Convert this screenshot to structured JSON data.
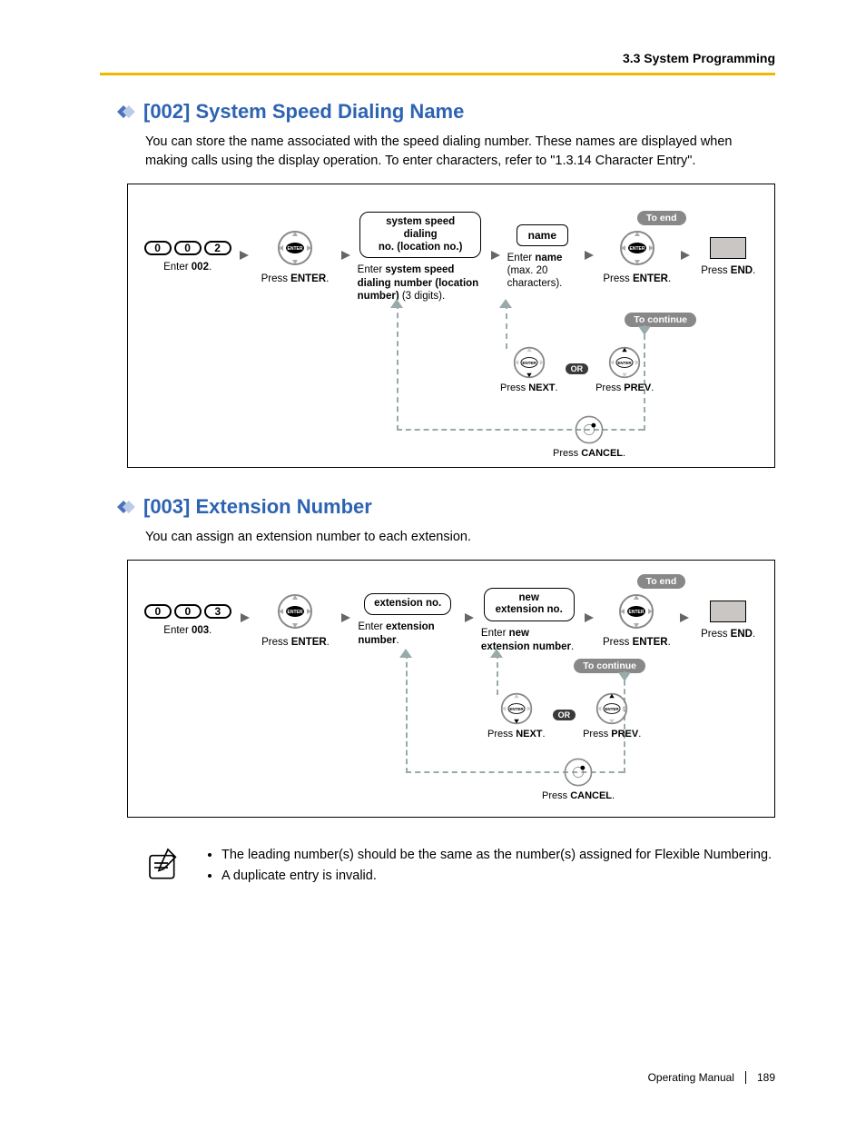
{
  "header": {
    "section": "3.3 System Programming"
  },
  "section1": {
    "heading": "[002] System Speed Dialing Name",
    "paragraph": "You can store the name associated with the speed dialing number. These names are displayed when making calls using the display operation. To enter characters, refer to \"1.3.14 Character Entry\".",
    "flow": {
      "step1": {
        "keys": [
          "0",
          "0",
          "2"
        ],
        "caption_a": "Enter ",
        "caption_b": "002",
        "caption_c": "."
      },
      "step2": {
        "caption_a": "Press ",
        "caption_b": "ENTER",
        "caption_c": "."
      },
      "step3": {
        "box_l1": "system speed dialing",
        "box_l2": "no. (location no.)",
        "cap_a": "Enter ",
        "cap_b": "system speed dialing number (location number)",
        "cap_c": " (3 digits)."
      },
      "step4": {
        "box": "name",
        "cap_a": "Enter ",
        "cap_b": "name",
        "cap_c": " (max. 20 characters)."
      },
      "step5": {
        "caption_a": "Press ",
        "caption_b": "ENTER",
        "caption_c": "."
      },
      "step6": {
        "caption_a": "Press ",
        "caption_b": "END",
        "caption_c": "."
      },
      "to_end": "To end",
      "to_continue": "To continue",
      "next": {
        "a": "Press ",
        "b": "NEXT",
        "c": "."
      },
      "prev": {
        "a": "Press ",
        "b": "PREV",
        "c": "."
      },
      "or": "OR",
      "cancel": {
        "a": "Press ",
        "b": "CANCEL",
        "c": "."
      }
    }
  },
  "section2": {
    "heading": "[003] Extension Number",
    "paragraph": "You can assign an extension number to each extension.",
    "flow": {
      "step1": {
        "keys": [
          "0",
          "0",
          "3"
        ],
        "caption_a": "Enter ",
        "caption_b": "003",
        "caption_c": "."
      },
      "step2": {
        "caption_a": "Press ",
        "caption_b": "ENTER",
        "caption_c": "."
      },
      "step3": {
        "box": "extension no.",
        "cap_a": "Enter ",
        "cap_b": "extension number",
        "cap_c": "."
      },
      "step4": {
        "box_l1": "new",
        "box_l2": "extension no.",
        "cap_a": "Enter ",
        "cap_b": "new extension number",
        "cap_c": "."
      },
      "step5": {
        "caption_a": "Press ",
        "caption_b": "ENTER",
        "caption_c": "."
      },
      "step6": {
        "caption_a": "Press ",
        "caption_b": "END",
        "caption_c": "."
      },
      "to_end": "To end",
      "to_continue": "To continue",
      "next": {
        "a": "Press ",
        "b": "NEXT",
        "c": "."
      },
      "prev": {
        "a": "Press ",
        "b": "PREV",
        "c": "."
      },
      "or": "OR",
      "cancel": {
        "a": "Press ",
        "b": "CANCEL",
        "c": "."
      }
    },
    "notes": [
      "The leading number(s) should be the same as the number(s) assigned for Flexible Numbering.",
      "A duplicate entry is invalid."
    ]
  },
  "footer": {
    "manual": "Operating Manual",
    "page": "189"
  }
}
